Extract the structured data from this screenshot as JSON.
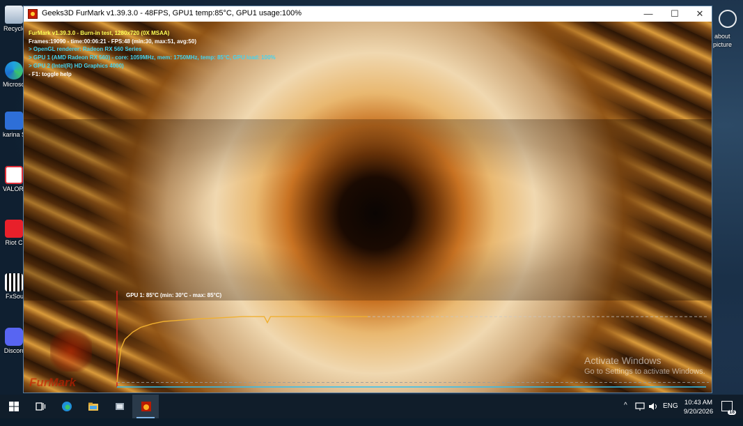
{
  "window": {
    "title": "Geeks3D FurMark v1.39.3.0 - 48FPS, GPU1 temp:85°C, GPU1 usage:100%",
    "minimize": "—",
    "maximize": "☐",
    "close": "✕"
  },
  "hud": {
    "line1": "FurMark v1.39.3.0 - Burn-in test, 1280x720 (0X MSAA)",
    "line2": "Frames:19090 - time:00:06:21 - FPS:48 (min:30, max:51, avg:50)",
    "line3": "> OpenGL renderer: Radeon RX 560 Series",
    "line4": "> GPU 1 (AMD Radeon RX 560) - core: 1059MHz, mem: 1750MHz, temp: 85°C, GPU load: 100%",
    "line5": "> GPU 2 (Intel(R) HD Graphics 4000)",
    "line6": "- F1: toggle help"
  },
  "graph": {
    "label": "GPU 1: 85°C (min: 30°C - max: 85°C)",
    "colors": {
      "curve": "#f0b030",
      "axis": "#d02020",
      "baseline": "#30c0f0"
    }
  },
  "chart_data": {
    "type": "line",
    "title": "GPU 1: 85°C (min: 30°C - max: 85°C)",
    "x": [
      0,
      5,
      10,
      20,
      30,
      45,
      60,
      80,
      100,
      130,
      160,
      188,
      192,
      196,
      230,
      280,
      320
    ],
    "series": [
      {
        "values": [
          30,
          58,
          66,
          72,
          76,
          79,
          81,
          82,
          83,
          84,
          85,
          85,
          80,
          85,
          85,
          85,
          85
        ]
      }
    ],
    "ylim": [
      25,
      95
    ]
  },
  "watermark": {
    "line1": "Activate Windows",
    "line2": "Go to Settings to activate Windows."
  },
  "desktop": {
    "icons": [
      {
        "label": "Recycle",
        "icon": "recycle-bin-icon"
      },
      {
        "label": "Microsoft Edge",
        "icon": "edge-icon"
      },
      {
        "label": "karina Short",
        "icon": "shortcut-icon"
      },
      {
        "label": "VALORANT",
        "icon": "valorant-icon"
      },
      {
        "label": "Riot Cl",
        "icon": "riot-client-icon"
      },
      {
        "label": "FxSou",
        "icon": "fxsound-icon"
      },
      {
        "label": "Discord",
        "icon": "discord-icon"
      }
    ],
    "right_text_1": "about",
    "right_text_2": "picture"
  },
  "taskbar": {
    "items": [
      "start-icon",
      "task-view-icon",
      "edge-icon",
      "file-explorer-icon",
      "snipping-icon",
      "furmark-icon"
    ],
    "tray_chevron": "^",
    "language": "ENG",
    "time": "10:43 AM",
    "date": "9/20/2026",
    "notification_count": "18"
  }
}
